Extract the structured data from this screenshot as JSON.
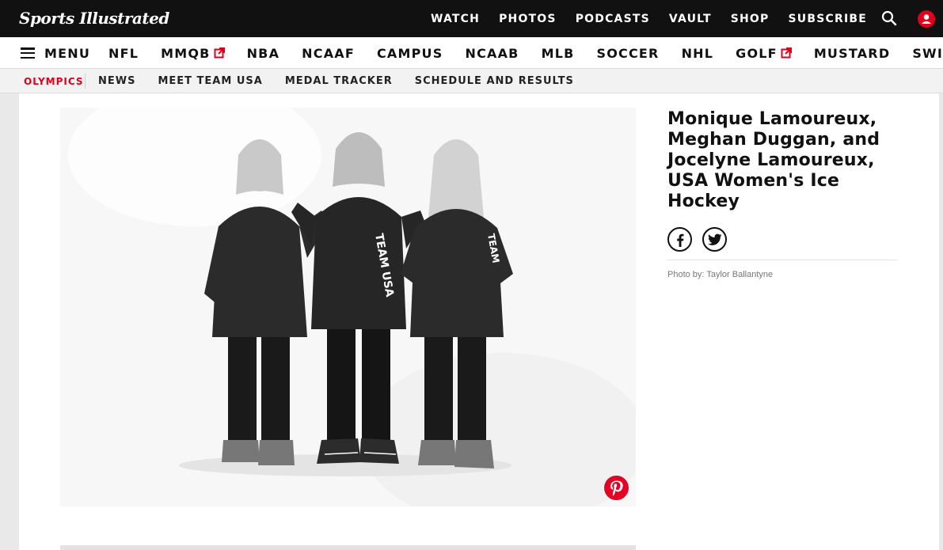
{
  "header": {
    "logo_text": "Sports Illustrated",
    "nav": [
      "WATCH",
      "PHOTOS",
      "PODCASTS",
      "VAULT",
      "SHOP",
      "SUBSCRIBE"
    ],
    "search_icon": "search-icon",
    "user_icon": "user-icon"
  },
  "main_nav": {
    "menu_label": "MENU",
    "items": [
      {
        "label": "NFL",
        "external": false
      },
      {
        "label": "MMQB",
        "external": true
      },
      {
        "label": "NBA",
        "external": false
      },
      {
        "label": "NCAAF",
        "external": false
      },
      {
        "label": "CAMPUS",
        "external": false
      },
      {
        "label": "NCAAB",
        "external": false
      },
      {
        "label": "MLB",
        "external": false
      },
      {
        "label": "SOCCER",
        "external": false
      },
      {
        "label": "NHL",
        "external": false
      },
      {
        "label": "GOLF",
        "external": true
      },
      {
        "label": "MUSTARD",
        "external": false
      },
      {
        "label": "SWIM",
        "external": true
      }
    ]
  },
  "sub_nav": {
    "section": "OLYMPICS",
    "items": [
      "NEWS",
      "MEET TEAM USA",
      "MEDAL TRACKER",
      "SCHEDULE AND RESULTS"
    ]
  },
  "gallery": {
    "caption_title": "Monique Lamoureux, Meghan Duggan, and Jocelyne Lamoureux, USA Women's Ice Hockey",
    "credit_label": "Photo by:",
    "credit_name": "Taylor Ballantyne",
    "share_icons": [
      "facebook-icon",
      "twitter-icon"
    ],
    "pin_icon": "pinterest-icon"
  },
  "colors": {
    "accent": "#e0001b",
    "header_bg": "#111111",
    "pinterest": "#e60023"
  }
}
